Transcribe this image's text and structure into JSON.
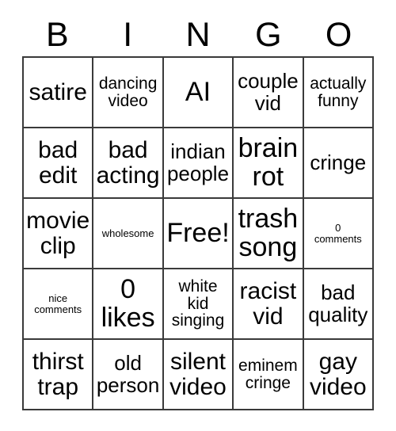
{
  "card": {
    "header": {
      "letters": [
        "B",
        "I",
        "N",
        "G",
        "O"
      ]
    },
    "columns": [
      {
        "letter": "B",
        "cells": [
          {
            "text": "satire",
            "size": "sz-lg"
          },
          {
            "text": "bad\nedit",
            "size": "sz-lg"
          },
          {
            "text": "movie\nclip",
            "size": "sz-lg"
          },
          {
            "text": "nice\ncomments",
            "size": "sz-xxs"
          },
          {
            "text": "thirst\ntrap",
            "size": "sz-lg"
          }
        ]
      },
      {
        "letter": "I",
        "cells": [
          {
            "text": "dancing\nvideo",
            "size": "sz-sm"
          },
          {
            "text": "bad\nacting",
            "size": "sz-lg"
          },
          {
            "text": "wholesome",
            "size": "sz-xxs"
          },
          {
            "text": "0\nlikes",
            "size": "sz-xl"
          },
          {
            "text": "old\nperson",
            "size": "sz-md"
          }
        ]
      },
      {
        "letter": "N",
        "cells": [
          {
            "text": "AI",
            "size": "sz-xl"
          },
          {
            "text": "indian\npeople",
            "size": "sz-md"
          },
          {
            "text": "Free!",
            "size": "sz-xl"
          },
          {
            "text": "white\nkid\nsinging",
            "size": "sz-sm"
          },
          {
            "text": "silent\nvideo",
            "size": "sz-lg"
          }
        ]
      },
      {
        "letter": "G",
        "cells": [
          {
            "text": "couple\nvid",
            "size": "sz-md"
          },
          {
            "text": "brain\nrot",
            "size": "sz-xl"
          },
          {
            "text": "trash\nsong",
            "size": "sz-xl"
          },
          {
            "text": "racist\nvid",
            "size": "sz-lg"
          },
          {
            "text": "eminem\ncringe",
            "size": "sz-sm"
          }
        ]
      },
      {
        "letter": "O",
        "cells": [
          {
            "text": "actually\nfunny",
            "size": "sz-sm"
          },
          {
            "text": "cringe",
            "size": "sz-md"
          },
          {
            "text": "0\ncomments",
            "size": "sz-xxs"
          },
          {
            "text": "bad\nquality",
            "size": "sz-md"
          },
          {
            "text": "gay\nvideo",
            "size": "sz-lg"
          }
        ]
      }
    ],
    "rows": [
      [
        {
          "text": "satire",
          "size": "sz-lg"
        },
        {
          "text": "dancing\nvideo",
          "size": "sz-sm"
        },
        {
          "text": "AI",
          "size": "sz-xl"
        },
        {
          "text": "couple\nvid",
          "size": "sz-md"
        },
        {
          "text": "actually\nfunny",
          "size": "sz-sm"
        }
      ],
      [
        {
          "text": "bad\nedit",
          "size": "sz-lg"
        },
        {
          "text": "bad\nacting",
          "size": "sz-lg"
        },
        {
          "text": "indian\npeople",
          "size": "sz-md"
        },
        {
          "text": "brain\nrot",
          "size": "sz-xl"
        },
        {
          "text": "cringe",
          "size": "sz-md"
        }
      ],
      [
        {
          "text": "movie\nclip",
          "size": "sz-lg"
        },
        {
          "text": "wholesome",
          "size": "sz-xxs"
        },
        {
          "text": "Free!",
          "size": "sz-xl"
        },
        {
          "text": "trash\nsong",
          "size": "sz-xl"
        },
        {
          "text": "0\ncomments",
          "size": "sz-xxs"
        }
      ],
      [
        {
          "text": "nice\ncomments",
          "size": "sz-xxs"
        },
        {
          "text": "0\nlikes",
          "size": "sz-xl"
        },
        {
          "text": "white\nkid\nsinging",
          "size": "sz-sm"
        },
        {
          "text": "racist\nvid",
          "size": "sz-lg"
        },
        {
          "text": "bad\nquality",
          "size": "sz-md"
        }
      ],
      [
        {
          "text": "thirst\ntrap",
          "size": "sz-lg"
        },
        {
          "text": "old\nperson",
          "size": "sz-md"
        },
        {
          "text": "silent\nvideo",
          "size": "sz-lg"
        },
        {
          "text": "eminem\ncringe",
          "size": "sz-sm"
        },
        {
          "text": "gay\nvideo",
          "size": "sz-lg"
        }
      ]
    ],
    "free_space": {
      "label": "Free!",
      "row": 2,
      "column": 2
    },
    "colors": {
      "border": "#3a3a3a",
      "background": "#ffffff",
      "text": "#000000"
    }
  }
}
